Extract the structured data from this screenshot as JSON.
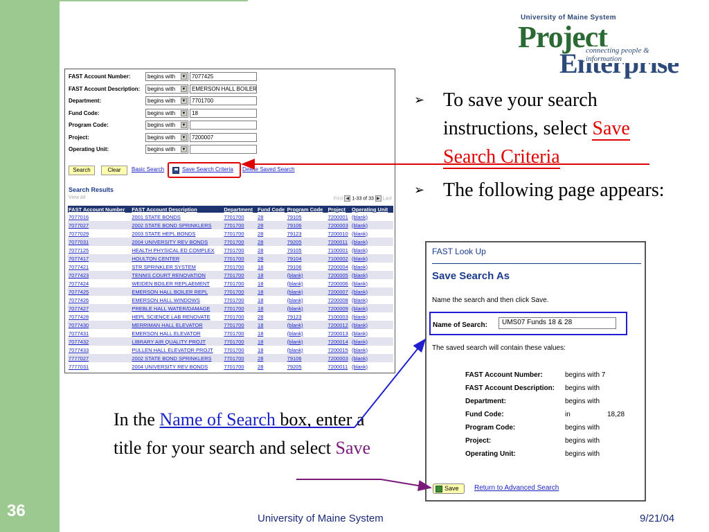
{
  "slide": {
    "number": "36"
  },
  "logo": {
    "top": "University of Maine System",
    "word1": "Project",
    "word2": "Enterprise",
    "tagline": "connecting people & information"
  },
  "criteria": [
    {
      "label": "FAST Account Number:",
      "operator": "begins with",
      "value": "7077425"
    },
    {
      "label": "FAST Account Description:",
      "operator": "begins with",
      "value": "EMERSON HALL BOILER"
    },
    {
      "label": "Department:",
      "operator": "begins with",
      "value": "7701700"
    },
    {
      "label": "Fund Code:",
      "operator": "begins with",
      "value": "18"
    },
    {
      "label": "Program Code:",
      "operator": "begins with",
      "value": ""
    },
    {
      "label": "Project:",
      "operator": "begins with",
      "value": "7200007"
    },
    {
      "label": "Operating Unit:",
      "operator": "begins with",
      "value": ""
    }
  ],
  "search_buttons": {
    "search": "Search",
    "clear": "Clear",
    "basic": "Basic Search",
    "save_criteria": "Save Search Criteria",
    "delete_saved": "Delete Saved Search"
  },
  "results": {
    "title": "Search Results",
    "view_all": "View All",
    "first": "First",
    "range": "1-33 of 33",
    "last": "Last",
    "columns": [
      "FAST Account Number",
      "FAST Account Description",
      "Department",
      "Fund Code",
      "Program Code",
      "Project",
      "Operating Unit"
    ],
    "rows": [
      [
        "7077016",
        "2001 STATE BONDS",
        "7701700",
        "28",
        "79105",
        "7200001",
        "(blank)"
      ],
      [
        "7077027",
        "2002 STATE BOND SPRINKLERS",
        "7701700",
        "28",
        "79106",
        "7200003",
        "(blank)"
      ],
      [
        "7077029",
        "2003 STATE HEPL BONDS",
        "7701700",
        "28",
        "79123",
        "7200010",
        "(blank)"
      ],
      [
        "7077031",
        "2004 UNIVERSITY REV BONDS",
        "7701700",
        "28",
        "79205",
        "7200011",
        "(blank)"
      ],
      [
        "7077125",
        "HEALTH PHYSICAL ED COMPLEX",
        "7701700",
        "28",
        "79105",
        "7100001",
        "(blank)"
      ],
      [
        "7077417",
        "HOULTON CENTER",
        "7701700",
        "28",
        "79104",
        "7100002",
        "(blank)"
      ],
      [
        "7077421",
        "STR SPRINKLER SYSTEM",
        "7701700",
        "18",
        "79106",
        "7200004",
        "(blank)"
      ],
      [
        "7077423",
        "TENNIS COURT RENOVATION",
        "7701700",
        "18",
        "(blank)",
        "7200005",
        "(blank)"
      ],
      [
        "7077424",
        "WEIDEN BOILER REPLAEMENT",
        "7701700",
        "18",
        "(blank)",
        "7200006",
        "(blank)"
      ],
      [
        "7077425",
        "EMERSON HALL BOILER REPL",
        "7701700",
        "18",
        "(blank)",
        "7200007",
        "(blank)"
      ],
      [
        "7077426",
        "EMERSON HALL WINDOWS",
        "7701700",
        "18",
        "(blank)",
        "7200008",
        "(blank)"
      ],
      [
        "7077427",
        "PREBLE HALL WATER/DAMAGE",
        "7701700",
        "18",
        "(blank)",
        "7200009",
        "(blank)"
      ],
      [
        "7077428",
        "HEPL SCIENCE LAB RENOVATE",
        "7701700",
        "28",
        "79123",
        "7100003",
        "(blank)"
      ],
      [
        "7077430",
        "MERRIMAN HALL ELEVATOR",
        "7701700",
        "18",
        "(blank)",
        "7200012",
        "(blank)"
      ],
      [
        "7077431",
        "EMERSON HALL ELEVATOR",
        "7701700",
        "18",
        "(blank)",
        "7200013",
        "(blank)"
      ],
      [
        "7077432",
        "LIBRARY AIR QUALITY PROJT",
        "7701700",
        "18",
        "(blank)",
        "7200014",
        "(blank)"
      ],
      [
        "7077433",
        "PULLEN HALL ELEVATOR PROJT",
        "7701700",
        "18",
        "(blank)",
        "7200015",
        "(blank)"
      ],
      [
        "7777027",
        "2002 STATE BOND SPRINKLERS",
        "7701700",
        "28",
        "79106",
        "7200003",
        "(blank)"
      ],
      [
        "7777031",
        "2004 UNIVERSITY REV BONDS",
        "7701700",
        "28",
        "79205",
        "7200011",
        "(blank)"
      ]
    ]
  },
  "bullets": {
    "b1_pre": "To save your search instructions, select ",
    "b1_red": "Save Search Criteria",
    "b2": "The following page appears:"
  },
  "saveas": {
    "header": "FAST Look Up",
    "title": "Save Search As",
    "instruction": "Name the search and then click Save.",
    "name_label": "Name of Search:",
    "name_value": "UMS07 Funds 18 & 28",
    "saved_note": "The saved search will contain these values:",
    "values": [
      {
        "label": "FAST Account Number:",
        "op": "begins with 7",
        "extra": ""
      },
      {
        "label": "FAST Account Description:",
        "op": "begins with",
        "extra": ""
      },
      {
        "label": "Department:",
        "op": "begins with",
        "extra": ""
      },
      {
        "label": "Fund Code:",
        "op": "in",
        "extra": "18,28"
      },
      {
        "label": "Program Code:",
        "op": "begins with",
        "extra": ""
      },
      {
        "label": "Project:",
        "op": "begins with",
        "extra": ""
      },
      {
        "label": "Operating Unit:",
        "op": "begins with",
        "extra": ""
      }
    ],
    "save_button": "Save",
    "return_link": "Return to Advanced Search"
  },
  "caption": {
    "pre": "In the ",
    "link": "Name of Search",
    "mid": " box, enter a title for your search and select ",
    "save": "Save"
  },
  "footer": {
    "center": "University of Maine System",
    "date": "9/21/04"
  },
  "colors": {
    "sidebar": "#9cc98f",
    "accent_red": "#e00000",
    "link_blue": "#1a24c8",
    "header_navy": "#1e3470"
  }
}
